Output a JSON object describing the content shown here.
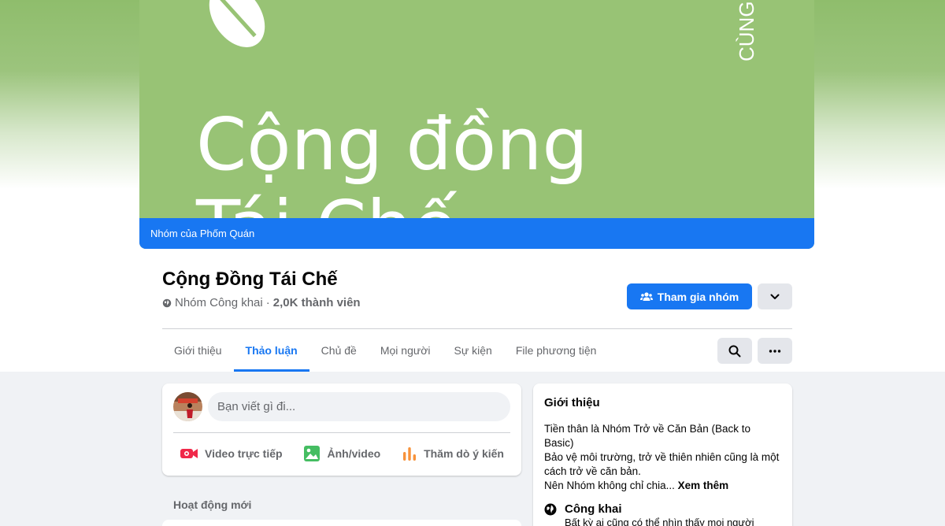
{
  "cover": {
    "title_line1": "Cộng đồng",
    "title_line2": "Tái Chế",
    "side_text": "CÙNG",
    "banner": "Nhóm của Phốm Quán"
  },
  "group": {
    "name": "Cộng Đồng Tái Chế",
    "privacy": "Nhóm Công khai",
    "separator": "·",
    "members": "2,0K thành viên"
  },
  "actions": {
    "join_label": "Tham gia nhóm"
  },
  "tabs": [
    {
      "label": "Giới thiệu",
      "active": false
    },
    {
      "label": "Thảo luận",
      "active": true
    },
    {
      "label": "Chủ đề",
      "active": false
    },
    {
      "label": "Mọi người",
      "active": false
    },
    {
      "label": "Sự kiện",
      "active": false
    },
    {
      "label": "File phương tiện",
      "active": false
    }
  ],
  "composer": {
    "placeholder": "Bạn viết gì đi...",
    "live_label": "Video trực tiếp",
    "photo_label": "Ảnh/video",
    "poll_label": "Thăm dò ý kiến"
  },
  "feed": {
    "recent_label": "Hoạt động mới"
  },
  "about": {
    "title": "Giới thiệu",
    "line1": "Tiền thân là Nhóm Trở về Căn Bản (Back to Basic)",
    "line2": "Bảo vệ môi trường, trở về thiên nhiên cũng là một cách trở về căn bản.",
    "line3": "Nên Nhóm không chỉ chia...",
    "see_more": "Xem thêm",
    "privacy_title": "Công khai",
    "privacy_desc": "Bất kỳ ai cũng có thể nhìn thấy mọi người"
  },
  "colors": {
    "primary": "#1877f2",
    "cover_green": "#98c375",
    "page_bg": "#f0f2f5"
  }
}
